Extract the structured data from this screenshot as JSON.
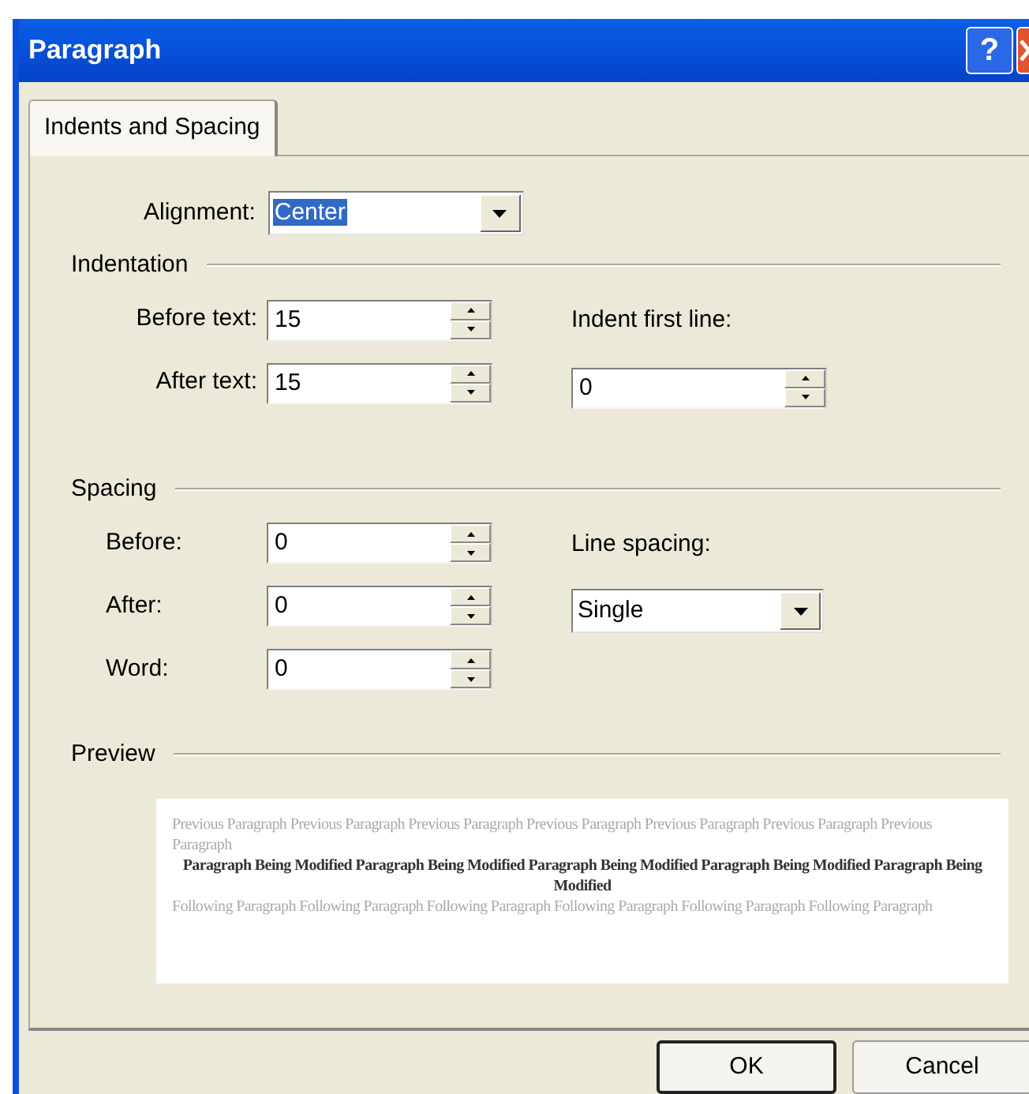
{
  "window": {
    "title": "Paragraph",
    "help_glyph": "?"
  },
  "tabs": [
    {
      "label": "Indents and Spacing",
      "selected": true
    }
  ],
  "alignment": {
    "label": "Alignment:",
    "value": "Center"
  },
  "indentation": {
    "heading": "Indentation",
    "fields": [
      {
        "label": "Before text:",
        "value": "15"
      },
      {
        "label": "After text:",
        "value": "15"
      }
    ],
    "first_line": {
      "label": "Indent first line:",
      "value": "0"
    }
  },
  "spacing": {
    "heading": "Spacing",
    "fields": [
      {
        "label": "Before:",
        "value": "0"
      },
      {
        "label": "After:",
        "value": "0"
      },
      {
        "label": "Word:",
        "value": "0"
      }
    ],
    "line_spacing": {
      "label": "Line spacing:",
      "value": "Single"
    }
  },
  "preview": {
    "heading": "Preview",
    "previous": "Previous Paragraph Previous Paragraph Previous Paragraph Previous Paragraph Previous Paragraph Previous Paragraph Previous Paragraph",
    "current": "Paragraph Being Modified Paragraph Being Modified Paragraph Being Modified Paragraph Being Modified Paragraph Being Modified",
    "following": "Following Paragraph Following Paragraph Following Paragraph Following Paragraph Following Paragraph Following Paragraph"
  },
  "buttons": [
    "OK",
    "Cancel"
  ]
}
